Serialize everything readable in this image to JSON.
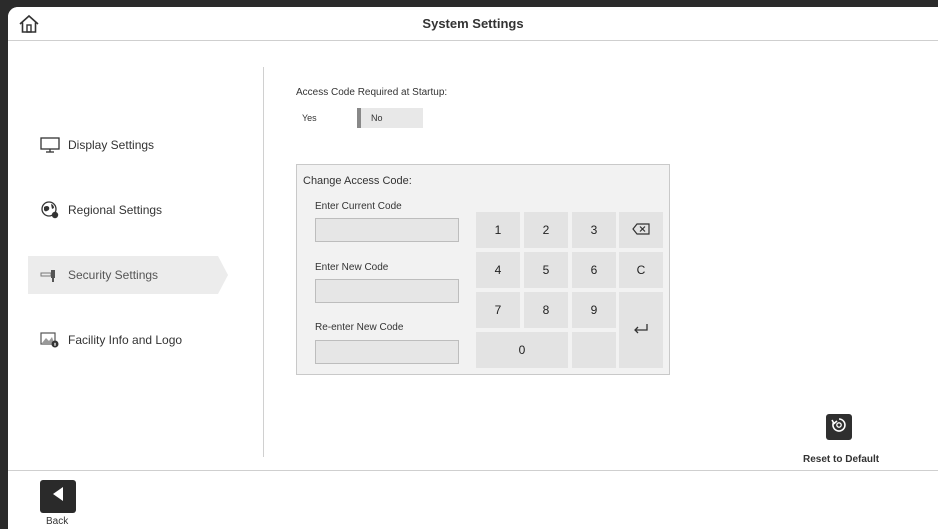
{
  "header": {
    "title": "System Settings",
    "home_icon": "home-icon"
  },
  "sidebar": {
    "items": [
      {
        "label": "Display Settings",
        "icon": "monitor-icon",
        "active": false
      },
      {
        "label": "Regional Settings",
        "icon": "globe-icon",
        "active": false
      },
      {
        "label": "Security Settings",
        "icon": "key-icon",
        "active": true
      },
      {
        "label": "Facility Info and Logo",
        "icon": "image-info-icon",
        "active": false
      }
    ]
  },
  "access": {
    "label": "Access Code Required at Startup:",
    "yes_label": "Yes",
    "no_label": "No",
    "selected": "No"
  },
  "change_code": {
    "title": "Change Access Code:",
    "current_label": "Enter Current Code",
    "new_label": "Enter New Code",
    "reenter_label": "Re-enter New Code",
    "current_value": "",
    "new_value": "",
    "reenter_value": ""
  },
  "keypad": {
    "k1": "1",
    "k2": "2",
    "k3": "3",
    "k4": "4",
    "k5": "5",
    "k6": "6",
    "k7": "7",
    "k8": "8",
    "k9": "9",
    "k0": "0",
    "clear": "C",
    "backspace_icon": "backspace-icon",
    "enter_icon": "enter-icon"
  },
  "reset": {
    "label": "Reset to Default",
    "icon": "reset-icon"
  },
  "footer": {
    "back_label": "Back",
    "back_icon": "back-arrow-icon"
  }
}
